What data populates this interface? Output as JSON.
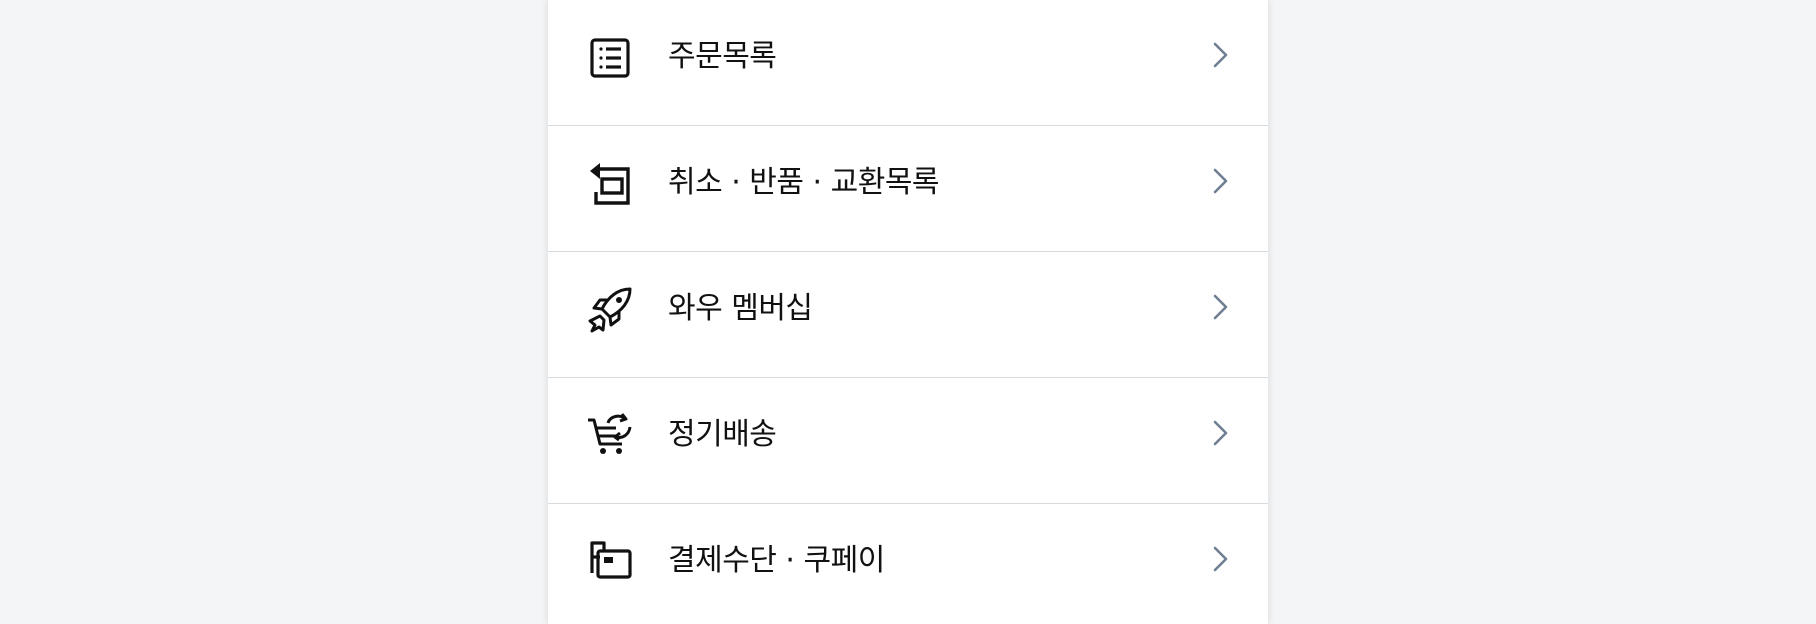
{
  "colors": {
    "page_background": "#f3f5f7",
    "panel_background": "#ffffff",
    "divider": "#d7dbe0",
    "text": "#111111",
    "chevron": "#6f7f92"
  },
  "menu": {
    "items": [
      {
        "label": "주문목록",
        "icon": "list-icon"
      },
      {
        "label": "취소 · 반품 · 교환목록",
        "icon": "return-icon"
      },
      {
        "label": "와우 멤버십",
        "icon": "rocket-icon"
      },
      {
        "label": "정기배송",
        "icon": "subscription-cart-icon"
      },
      {
        "label": "결제수단 · 쿠페이",
        "icon": "wallet-icon"
      }
    ]
  }
}
